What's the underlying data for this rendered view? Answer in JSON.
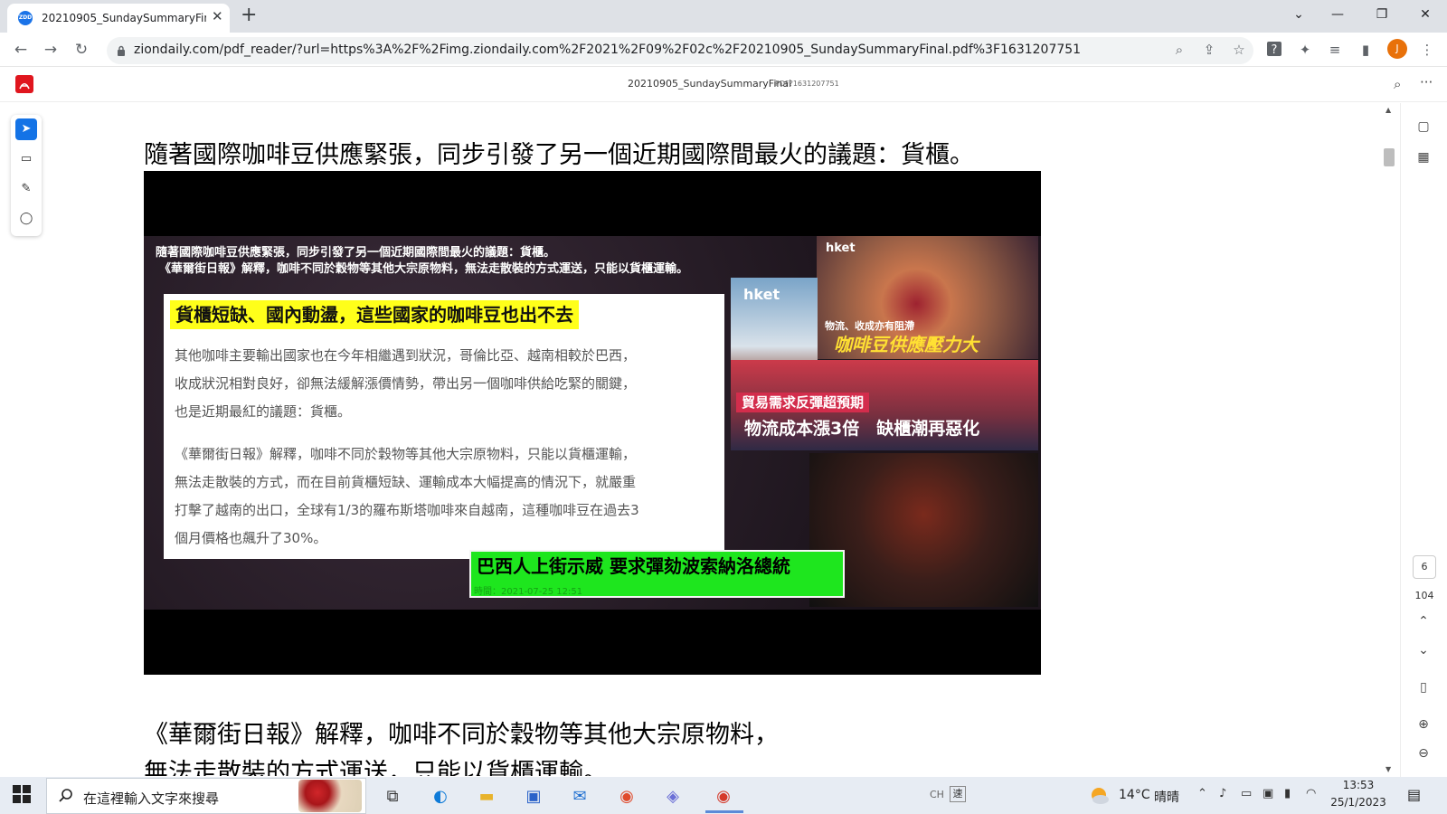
{
  "browser": {
    "tab_title": "20210905_SundaySummaryFin",
    "favicon_label": "ZDD",
    "url": "ziondaily.com/pdf_reader/?url=https%3A%2F%2Fimg.ziondaily.com%2F2021%2F09%2F02c%2F20210905_SundaySummaryFinal.pdf%3F1631207751",
    "profile_initial": "J"
  },
  "pdf_viewer": {
    "file_name": "20210905_SundaySummaryFinal",
    "file_suffix": "PDF?1631207751",
    "current_page": "6",
    "total_pages": "104"
  },
  "document": {
    "paragraph_1": "隨著國際咖啡豆供應緊張，同步引發了另一個近期國際間最火的議題：貨櫃。",
    "paragraph_2": "《華爾街日報》解釋，咖啡不同於穀物等其他大宗原物料，",
    "paragraph_3": "無法走散裝的方式運送，只能以貨櫃運輸。"
  },
  "slide": {
    "caption_1": "隨著國際咖啡豆供應緊張，同步引發了另一個近期國際間最火的議題：貨櫃。",
    "caption_2": "《華爾街日報》解釋，咖啡不同於穀物等其他大宗原物料，無法走散裝的方式運送，只能以貨櫃運輸。",
    "card_title": "貨櫃短缺、國內動盪，這些國家的咖啡豆也出不去",
    "card_p1_l1": "其他咖啡主要輸出國家也在今年相繼遇到狀況，哥倫比亞、越南相較於巴西，",
    "card_p1_l2": "收成狀況相對良好，卻無法緩解漲價情勢，帶出另一個咖啡供給吃緊的關鍵，",
    "card_p1_l3": "也是近期最紅的議題：貨櫃。",
    "card_p2_l1": "《華爾街日報》解釋，咖啡不同於穀物等其他大宗原物料，只能以貨櫃運輸，",
    "card_p2_l2": "無法走散裝的方式，而在目前貨櫃短缺、運輸成本大幅提高的情況下，就嚴重",
    "card_p2_l3": "打擊了越南的出口，全球有1/3的羅布斯塔咖啡來自越南，這種咖啡豆在過去3",
    "card_p2_l4": "個月價格也飆升了30%。",
    "hket_1": "hket",
    "hket_2": "hket",
    "logistics_small": "物流、收成亦有阻滯",
    "coffee_pressure": "咖啡豆供應壓力大",
    "trade_demand": "貿易需求反彈超預期",
    "logistics_cost": "物流成本漲3倍　缺櫃潮再惡化",
    "brazil_protest": "巴西人上街示威 要求彈劾波索納洛總統",
    "brazil_time": "時間：2021-07-25 12:51"
  },
  "taskbar": {
    "search_placeholder": "在這裡輸入文字來搜尋",
    "ime_lang": "CH",
    "ime_mode": "速",
    "temperature": "14°C",
    "weather": "晴晴",
    "time": "13:53",
    "date": "25/1/2023"
  },
  "colors": {
    "highlight_yellow": "#ffff1a",
    "protest_green": "#1ee61e",
    "acrobat_red": "#e0161e",
    "chrome_tab_bg": "#dee1e6",
    "taskbar_bg": "#e7ecf3"
  }
}
